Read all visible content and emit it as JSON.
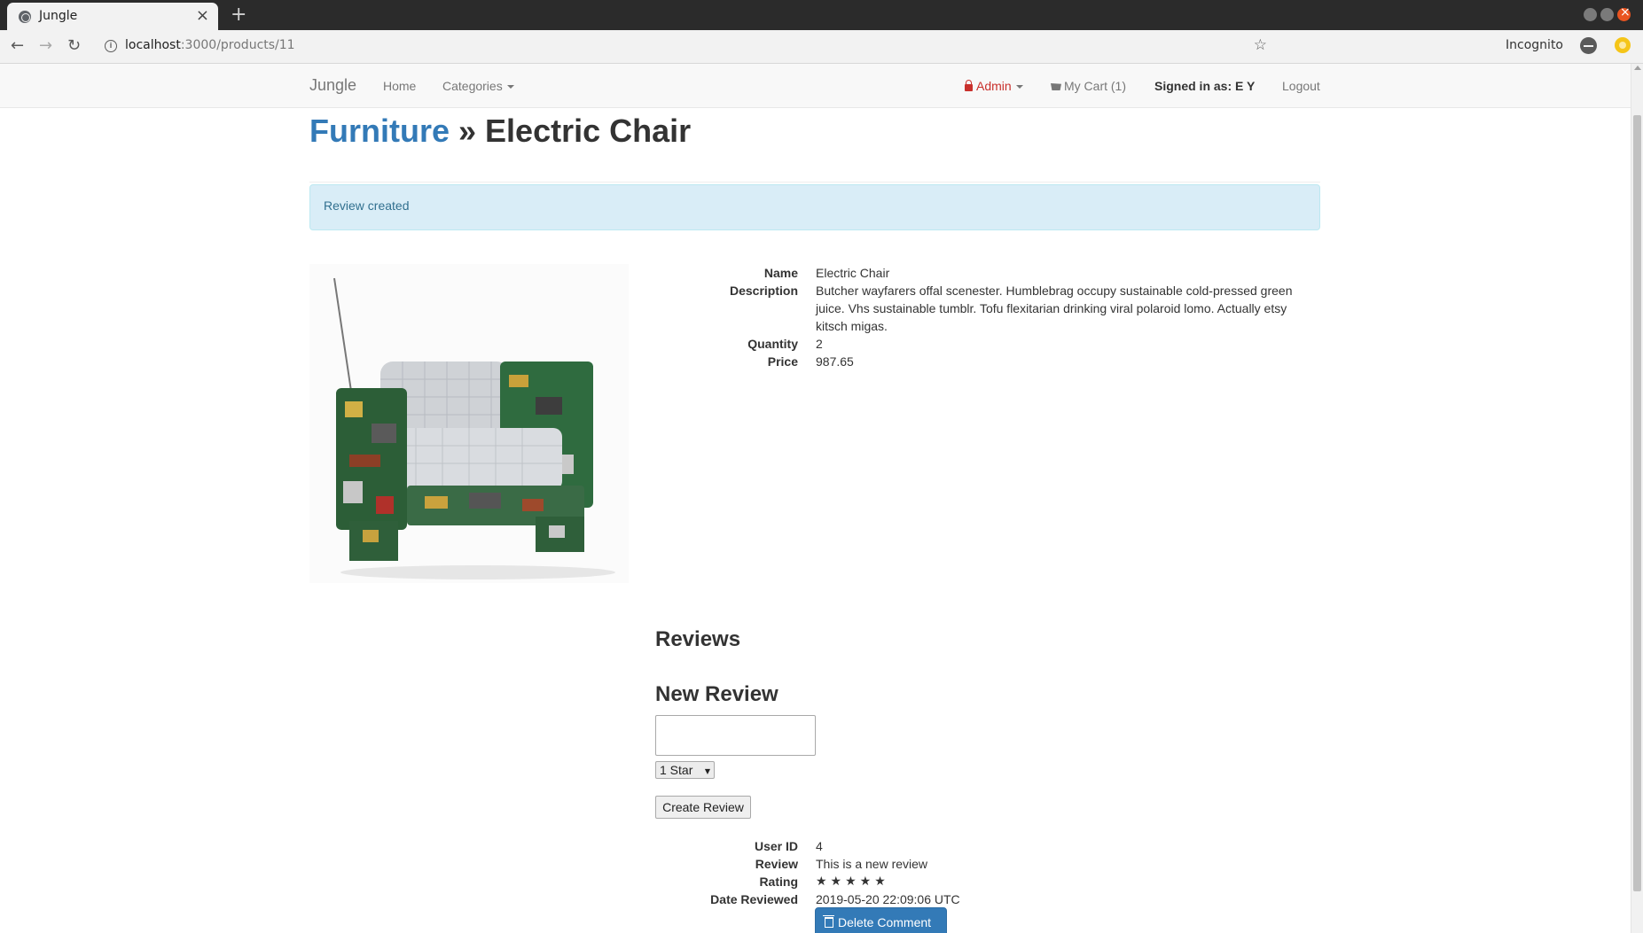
{
  "browser": {
    "tab_title": "Jungle",
    "tab_close": "×",
    "new_tab": "+",
    "nav_back": "←",
    "nav_forward": "→",
    "nav_reload": "↻",
    "url_host": "localhost",
    "url_path": ":3000/products/11",
    "bookmark_star": "☆",
    "incognito_label": "Incognito"
  },
  "navbar": {
    "brand": "Jungle",
    "home": "Home",
    "categories": "Categories",
    "admin": "Admin",
    "cart": "My Cart (1)",
    "signed_in": "Signed in as: E Y",
    "logout": "Logout"
  },
  "header": {
    "category": "Furniture",
    "separator": " » ",
    "product_name": "Electric Chair"
  },
  "alert": {
    "message": "Review created"
  },
  "product": {
    "name_label": "Name",
    "name": "Electric Chair",
    "description_label": "Description",
    "description": "Butcher wayfarers offal scenester. Humblebrag occupy sustainable cold-pressed green juice. Vhs sustainable tumblr. Tofu flexitarian drinking viral polaroid lomo. Actually etsy kitsch migas.",
    "quantity_label": "Quantity",
    "quantity": "2",
    "price_label": "Price",
    "price": "987.65"
  },
  "reviews": {
    "title": "Reviews",
    "new_review_title": "New Review",
    "textarea_value": "",
    "rating_selected": "1 Star",
    "create_button": "Create Review",
    "items": [
      {
        "user_id_label": "User ID",
        "user_id": "4",
        "review_label": "Review",
        "review": "This is a new review",
        "rating_label": "Rating",
        "rating_stars": "★★★★★",
        "rating_value": 5,
        "date_label": "Date Reviewed",
        "date": "2019-05-20 22:09:06 UTC",
        "delete_button": "Delete Comment"
      }
    ]
  },
  "colors": {
    "link": "#337ab7",
    "admin": "#c9302c",
    "alert_bg": "#d9edf7",
    "alert_text": "#31708f",
    "primary_button": "#337ab7"
  }
}
